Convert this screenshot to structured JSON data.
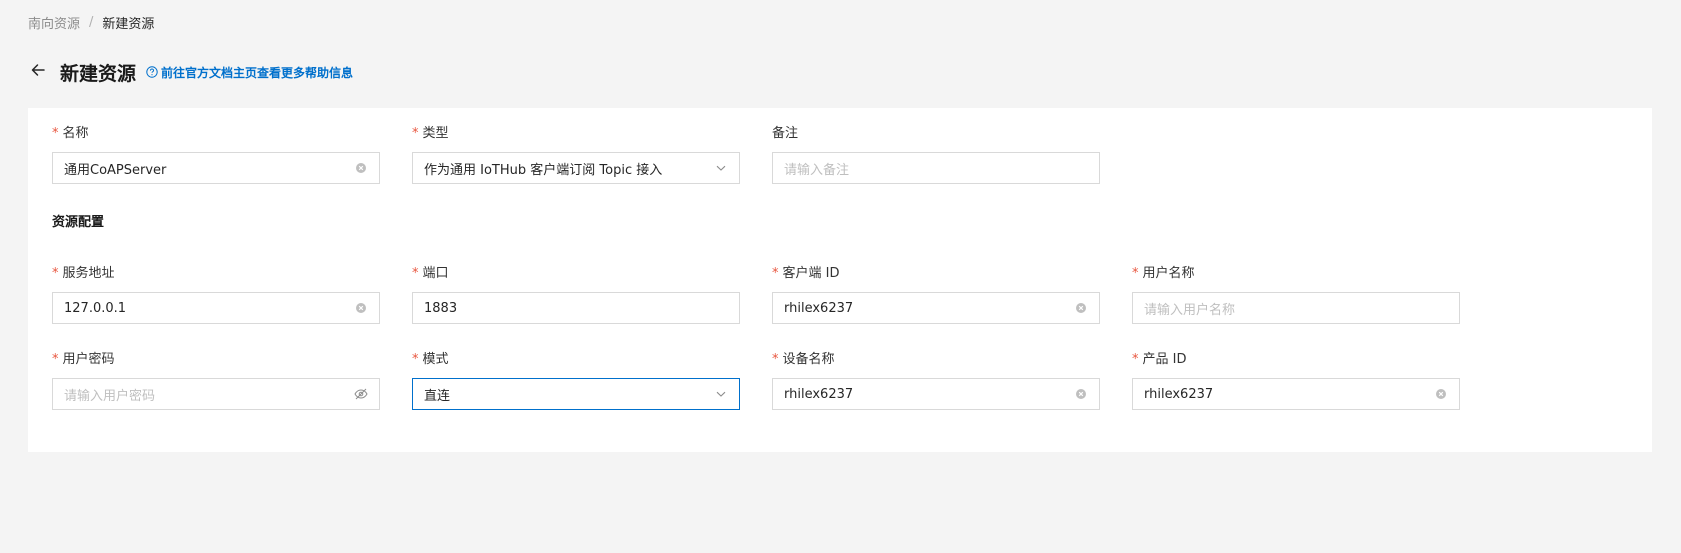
{
  "breadcrumb": {
    "parent": "南向资源",
    "separator": "/",
    "current": "新建资源"
  },
  "header": {
    "title": "新建资源",
    "help_text": "前往官方文档主页查看更多帮助信息"
  },
  "form": {
    "name": {
      "label": "名称",
      "required": "*",
      "value": "通用CoAPServer"
    },
    "type": {
      "label": "类型",
      "required": "*",
      "value": "作为通用 IoTHub 客户端订阅 Topic 接入"
    },
    "remark": {
      "label": "备注",
      "placeholder": "请输入备注"
    },
    "section_title": "资源配置",
    "host": {
      "label": "服务地址",
      "required": "*",
      "value": "127.0.0.1"
    },
    "port": {
      "label": "端口",
      "required": "*",
      "value": "1883"
    },
    "client_id": {
      "label": "客户端 ID",
      "required": "*",
      "value": "rhilex6237"
    },
    "username": {
      "label": "用户名称",
      "required": "*",
      "placeholder": "请输入用户名称"
    },
    "password": {
      "label": "用户密码",
      "required": "*",
      "placeholder": "请输入用户密码"
    },
    "mode": {
      "label": "模式",
      "required": "*",
      "value": "直连"
    },
    "device_name": {
      "label": "设备名称",
      "required": "*",
      "value": "rhilex6237"
    },
    "product_id": {
      "label": "产品 ID",
      "required": "*",
      "value": "rhilex6237"
    }
  },
  "colors": {
    "accent": "#0070cc",
    "required": "#e8553e",
    "background": "#f4f4f4"
  },
  "icons": {
    "back": "arrow-left-icon",
    "help": "question-circle-icon",
    "clear": "close-circle-icon",
    "dropdown": "chevron-down-icon",
    "password": "eye-invisible-icon"
  }
}
